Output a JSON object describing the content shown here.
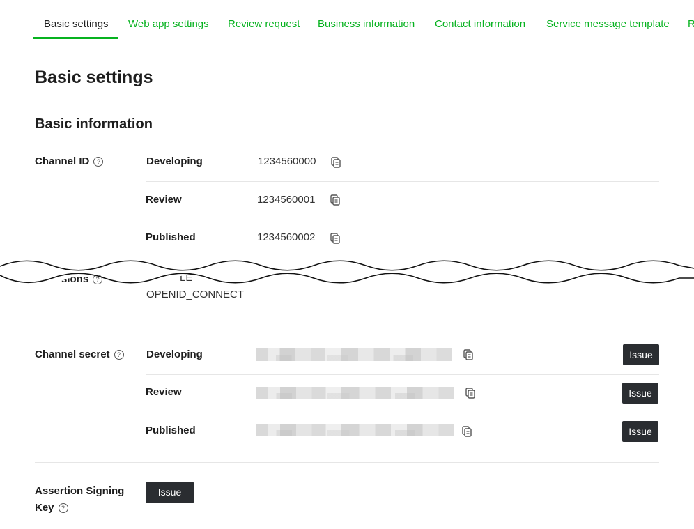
{
  "tabs": [
    {
      "label": "Basic settings"
    },
    {
      "label": "Web app settings"
    },
    {
      "label": "Review request"
    },
    {
      "label": "Business information"
    },
    {
      "label": "Contact information"
    },
    {
      "label": "Service message template"
    },
    {
      "label": "R"
    }
  ],
  "page_title": "Basic settings",
  "section_title": "Basic information",
  "channel_id": {
    "label": "Channel ID",
    "help_icon": "question-circle-icon",
    "rows": [
      {
        "env": "Developing",
        "value": "1234560000"
      },
      {
        "env": "Review",
        "value": "1234560001"
      },
      {
        "env": "Published",
        "value": "1234560002"
      }
    ]
  },
  "permissions": {
    "label_fragment": "sions",
    "partial_value": "LE",
    "value": "OPENID_CONNECT"
  },
  "channel_secret": {
    "label": "Channel secret",
    "help_icon": "question-circle-icon",
    "rows": [
      {
        "env": "Developing",
        "issue_label": "Issue"
      },
      {
        "env": "Review",
        "issue_label": "Issue"
      },
      {
        "env": "Published",
        "issue_label": "Issue"
      }
    ]
  },
  "assertion_signing_key": {
    "label_line1": "Assertion Signing",
    "label_line2": "Key",
    "help_icon": "question-circle-icon",
    "issue_label": "Issue"
  },
  "icons": {
    "copy": "copy-icon",
    "help": "question-circle-icon"
  },
  "colors": {
    "accent": "#06b21f",
    "text": "#1e1e1e",
    "button": "#2a2d31",
    "divider": "#e6e6e6"
  }
}
